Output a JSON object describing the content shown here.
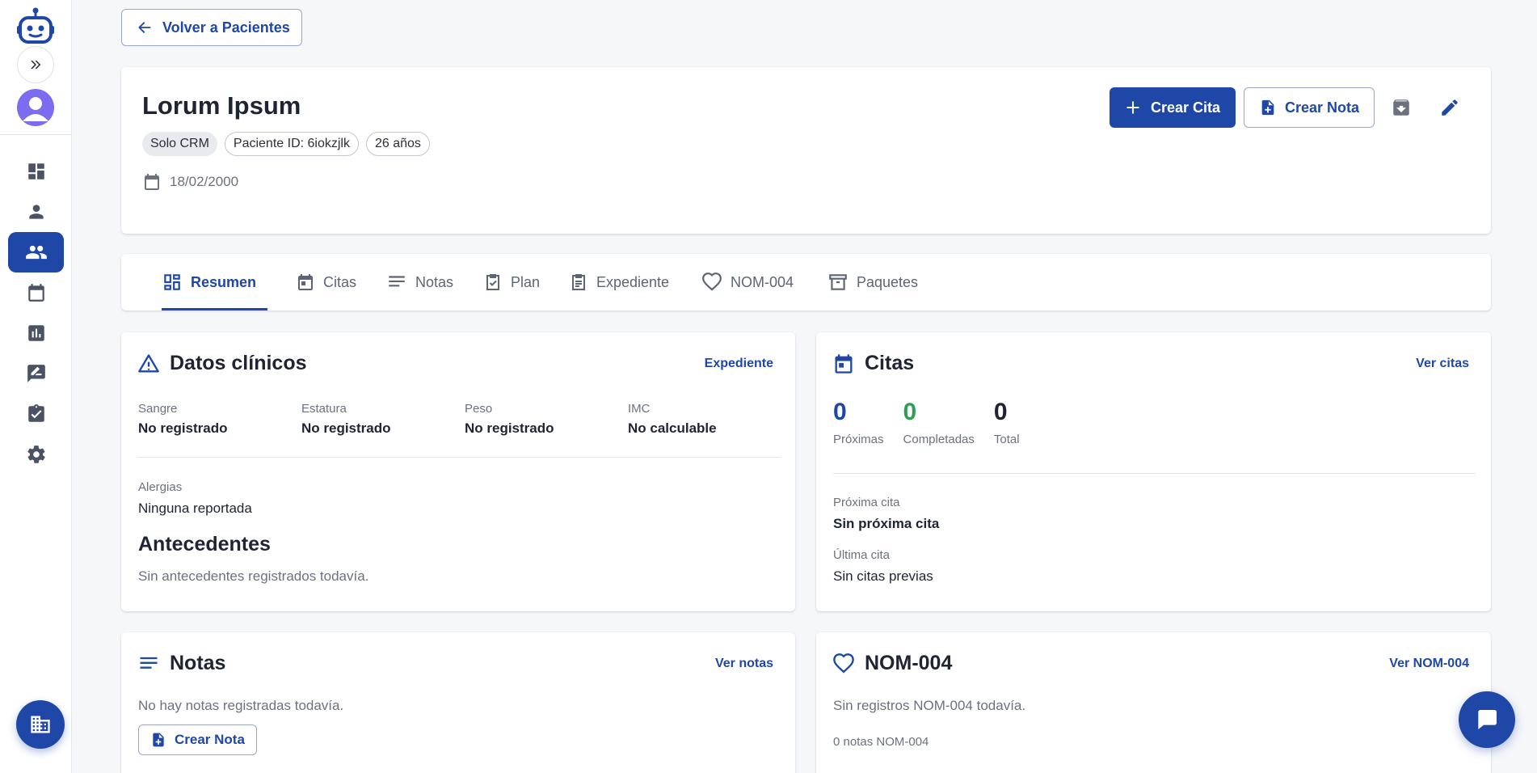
{
  "nav": {
    "back_label": "Volver a Pacientes"
  },
  "patient": {
    "name": "Lorum Ipsum",
    "chips": [
      "Solo CRM",
      "Paciente ID: 6iokzjlk",
      "26 años"
    ],
    "birth_date": "18/02/2000"
  },
  "actions": {
    "create_appointment": "Crear Cita",
    "create_note": "Crear Nota"
  },
  "tabs": [
    {
      "label": "Resumen",
      "icon": "dashboard-icon"
    },
    {
      "label": "Citas",
      "icon": "calendar-icon"
    },
    {
      "label": "Notas",
      "icon": "notes-icon"
    },
    {
      "label": "Plan",
      "icon": "checklist-icon"
    },
    {
      "label": "Expediente",
      "icon": "clipboard-icon"
    },
    {
      "label": "NOM-004",
      "icon": "heart-icon"
    },
    {
      "label": "Paquetes",
      "icon": "archive-icon"
    }
  ],
  "clinical": {
    "title": "Datos clínicos",
    "link": "Expediente",
    "fields": [
      {
        "label": "Sangre",
        "value": "No registrado"
      },
      {
        "label": "Estatura",
        "value": "No registrado"
      },
      {
        "label": "Peso",
        "value": "No registrado"
      },
      {
        "label": "IMC",
        "value": "No calculable"
      }
    ],
    "allergies_label": "Alergias",
    "allergies_value": "Ninguna reportada",
    "history_title": "Antecedentes",
    "history_empty": "Sin antecedentes registrados todavía."
  },
  "appointments": {
    "title": "Citas",
    "link": "Ver citas",
    "stats": [
      {
        "value": "0",
        "label": "Próximas",
        "color": "#1f47a8"
      },
      {
        "value": "0",
        "label": "Completadas",
        "color": "#2e9e55"
      },
      {
        "value": "0",
        "label": "Total",
        "color": "#1f2433"
      }
    ],
    "next_label": "Próxima cita",
    "next_value": "Sin próxima cita",
    "last_label": "Última cita",
    "last_value": "Sin citas previas"
  },
  "notes": {
    "title": "Notas",
    "link": "Ver notas",
    "empty": "No hay notas registradas todavía.",
    "create": "Crear Nota"
  },
  "nom004": {
    "title": "NOM-004",
    "link": "Ver NOM-004",
    "empty": "Sin registros NOM-004 todavía.",
    "count": "0 notas NOM-004"
  },
  "sidebar": {
    "items": [
      "dashboard-icon",
      "person-icon",
      "people-icon",
      "calendar-icon",
      "chart-icon",
      "feedback-icon",
      "checklist-icon",
      "gear-icon"
    ],
    "active_index": 2
  },
  "colors": {
    "primary": "#1f47a8",
    "success": "#2e9e55",
    "avatar": "#7b6cf0"
  }
}
